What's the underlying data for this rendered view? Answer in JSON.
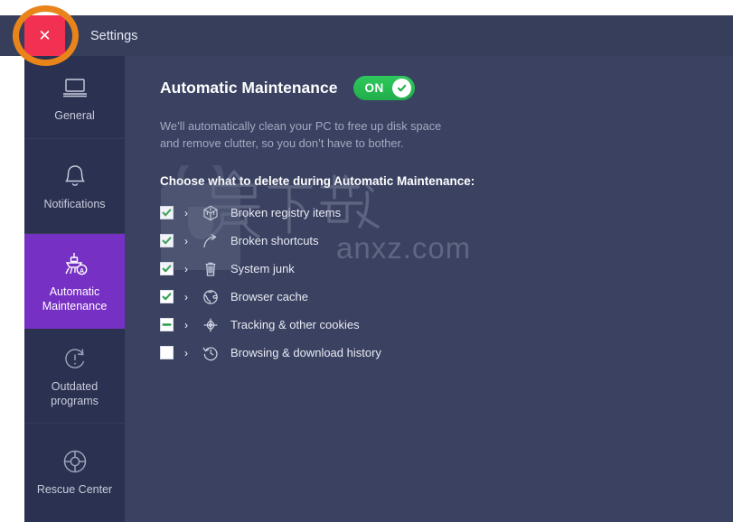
{
  "window": {
    "title": "Settings",
    "close_label": "✕"
  },
  "colors": {
    "accent_purple": "#7730c4",
    "close_red": "#f23051",
    "toggle_green": "#2ec95c",
    "highlight_orange": "#e8841a",
    "sidebar_bg": "#2b3150",
    "main_bg": "#3a4161",
    "titlebar_bg": "#363e5c"
  },
  "sidebar": {
    "items": [
      {
        "label": "General",
        "icon": "laptop-icon",
        "active": false
      },
      {
        "label": "Notifications",
        "icon": "bell-icon",
        "active": false
      },
      {
        "label": "Automatic\nMaintenance",
        "icon": "auto-maintenance-icon",
        "active": true
      },
      {
        "label": "Outdated\nprograms",
        "icon": "outdated-warning-icon",
        "active": false
      },
      {
        "label": "Rescue Center",
        "icon": "lifebuoy-icon",
        "active": false
      }
    ]
  },
  "main": {
    "heading": "Automatic Maintenance",
    "toggle": {
      "state_label": "ON",
      "checked": true,
      "icon": "check-circle-icon"
    },
    "description": "We’ll automatically clean your PC to free up disk space\nand remove clutter, so you don’t have to bother.",
    "section_title": "Choose what to delete during Automatic Maintenance:",
    "chevron": "›",
    "options": [
      {
        "label": "Broken registry items",
        "state": "checked",
        "icon": "registry-cube-icon"
      },
      {
        "label": "Broken shortcuts",
        "state": "checked",
        "icon": "shortcut-arrow-icon"
      },
      {
        "label": "System junk",
        "state": "checked",
        "icon": "trash-bin-icon"
      },
      {
        "label": "Browser cache",
        "state": "checked",
        "icon": "globe-icon"
      },
      {
        "label": "Tracking & other cookies",
        "state": "indeterminate",
        "icon": "tracking-crosshair-icon"
      },
      {
        "label": "Browsing & download history",
        "state": "unchecked",
        "icon": "clock-history-icon"
      }
    ]
  },
  "watermark": {
    "text": "anxz.com",
    "cjk": "安下载"
  }
}
